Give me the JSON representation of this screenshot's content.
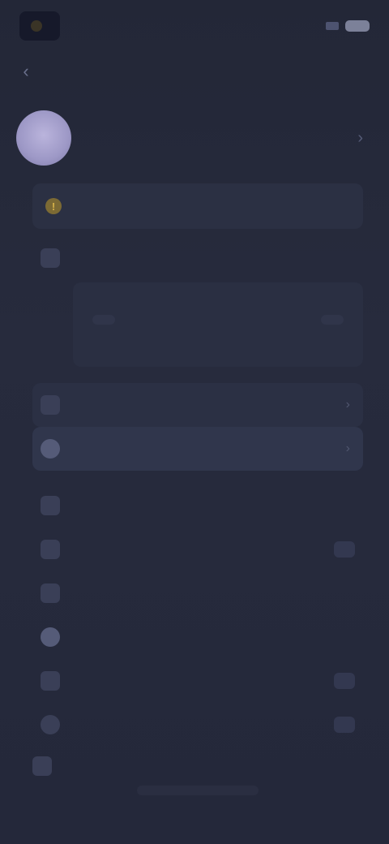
{
  "status": {
    "app_label": "",
    "time": ""
  },
  "nav": {
    "back_glyph": "‹"
  },
  "profile": {
    "name": "",
    "subtitle": "",
    "chevron": "›"
  },
  "notice": {
    "icon_glyph": "!",
    "text": ""
  },
  "sync": {
    "title": "",
    "description": "",
    "primary_button": "",
    "secondary_button": ""
  },
  "menu_top": [
    {
      "label": "",
      "trail": "›"
    },
    {
      "label": "",
      "trail": "›"
    }
  ],
  "menu_main": [
    {
      "label": "",
      "badge": ""
    },
    {
      "label": "",
      "badge": ""
    },
    {
      "label": "",
      "badge": ""
    },
    {
      "label": "",
      "badge": ""
    },
    {
      "label": "",
      "badge": ""
    },
    {
      "label": "",
      "badge": ""
    }
  ],
  "footer": {
    "link": ""
  },
  "icons": {
    "back": "chevron-left-icon",
    "notice": "warning-icon",
    "sync": "cloud-sync-icon"
  },
  "colors": {
    "background": "#262a3b",
    "card": "#2b3044",
    "avatar": "#b3add6",
    "warning": "#d6b24a"
  }
}
